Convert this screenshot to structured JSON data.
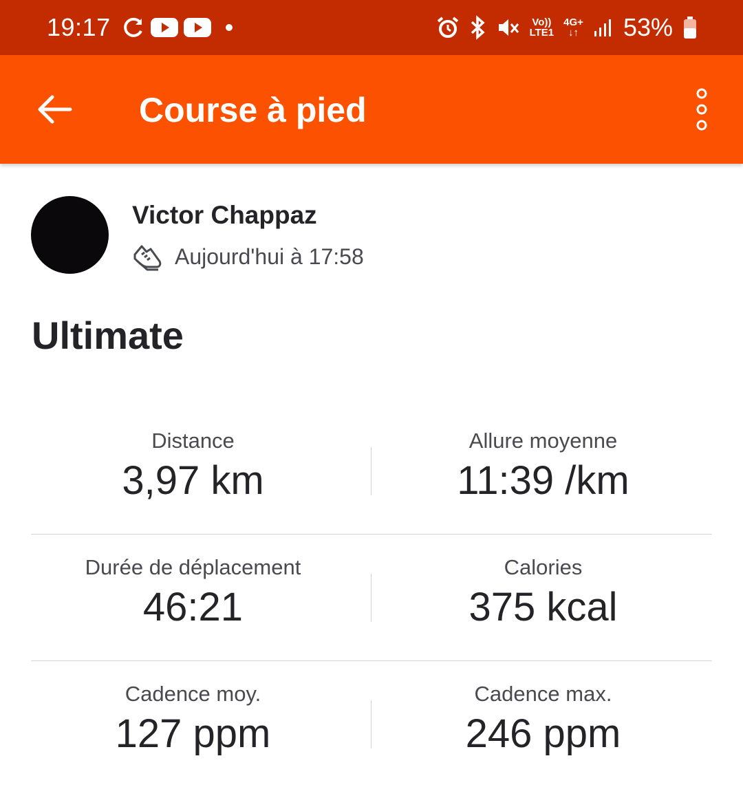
{
  "status_bar": {
    "time": "19:17",
    "battery_percent": "53%",
    "network_top": "Vo))",
    "network_bottom": "LTE1",
    "data_type": "4G+",
    "data_arrows": "↓↑",
    "icons": [
      "sync-icon",
      "youtube-icon",
      "youtube-icon",
      "notification-dot-icon",
      "alarm-icon",
      "bluetooth-icon",
      "mute-icon",
      "volte-icon",
      "4g-icon",
      "signal-icon",
      "battery-icon"
    ]
  },
  "app_bar": {
    "title": "Course à pied",
    "back_icon": "arrow-left-icon",
    "menu_icon": "more-vertical-icon",
    "background_color": "#fc5200"
  },
  "athlete": {
    "name": "Victor Chappaz",
    "activity_type_icon": "running-shoe-icon",
    "timestamp": "Aujourd'hui à 17:58"
  },
  "activity": {
    "title": "Ultimate"
  },
  "stats": [
    {
      "label": "Distance",
      "value": "3,97 km"
    },
    {
      "label": "Allure moyenne",
      "value": "11:39 /km"
    },
    {
      "label": "Durée de déplacement",
      "value": "46:21"
    },
    {
      "label": "Calories",
      "value": "375 kcal"
    },
    {
      "label": "Cadence moy.",
      "value": "127 ppm"
    },
    {
      "label": "Cadence max.",
      "value": "246 ppm"
    }
  ]
}
